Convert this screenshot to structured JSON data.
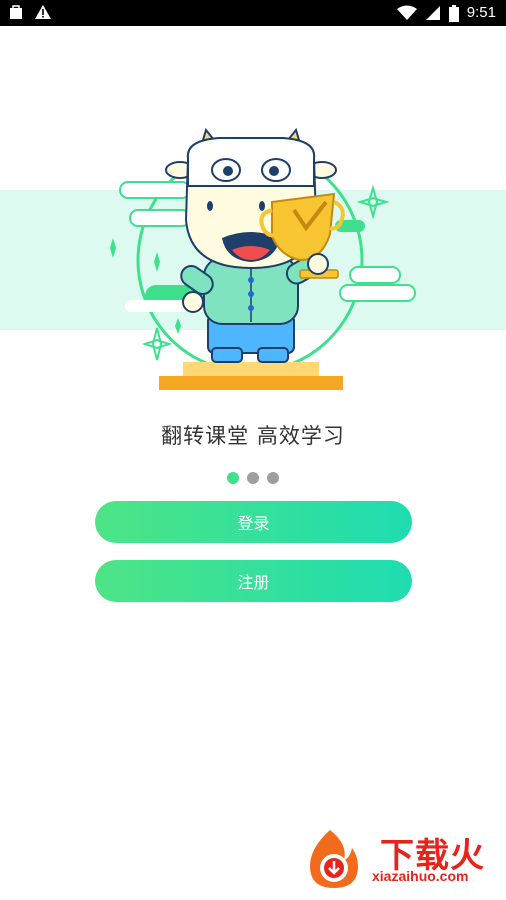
{
  "status_bar": {
    "time": "9:51",
    "icons": [
      "bag-icon",
      "warning-icon",
      "wifi-icon",
      "signal-icon",
      "battery-icon"
    ]
  },
  "hero": {
    "illustration": "cow-mascot-with-trophy",
    "colors": {
      "band": "#dcfaf0",
      "accent": "#3ee08e",
      "podium": "#f5a623"
    }
  },
  "tagline": "翻转课堂 高效学习",
  "pager": {
    "count": 3,
    "active": 0
  },
  "buttons": {
    "login": "登录",
    "register": "注册"
  },
  "colors": {
    "gradient_start": "#4ee486",
    "gradient_end": "#1edcb0",
    "dot_active": "#3ee08e",
    "dot_inactive": "#9e9e9e"
  },
  "watermark": {
    "title": "下载火",
    "url": "xiazaihuo.com"
  }
}
